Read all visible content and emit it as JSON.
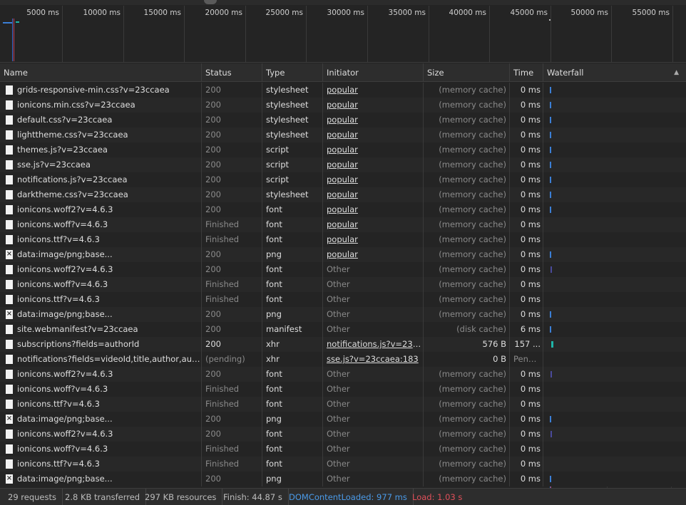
{
  "overview": {
    "ticks": [
      "5000 ms",
      "10000 ms",
      "15000 ms",
      "20000 ms",
      "25000 ms",
      "30000 ms",
      "35000 ms",
      "40000 ms",
      "45000 ms",
      "50000 ms",
      "55000 ms"
    ]
  },
  "columns": {
    "name": "Name",
    "status": "Status",
    "type": "Type",
    "initiator": "Initiator",
    "size": "Size",
    "time": "Time",
    "waterfall": "Waterfall"
  },
  "sort_icon": "triangle-up-icon",
  "rows": [
    {
      "name": "grids-responsive-min.css?v=23ccaea",
      "status": "200",
      "type": "stylesheet",
      "initiator": "popular",
      "init_link": true,
      "size": "(memory cache)",
      "time": "0 ms",
      "icon": "file"
    },
    {
      "name": "ionicons.min.css?v=23ccaea",
      "status": "200",
      "type": "stylesheet",
      "initiator": "popular",
      "init_link": true,
      "size": "(memory cache)",
      "time": "0 ms",
      "icon": "file"
    },
    {
      "name": "default.css?v=23ccaea",
      "status": "200",
      "type": "stylesheet",
      "initiator": "popular",
      "init_link": true,
      "size": "(memory cache)",
      "time": "0 ms",
      "icon": "file"
    },
    {
      "name": "lighttheme.css?v=23ccaea",
      "status": "200",
      "type": "stylesheet",
      "initiator": "popular",
      "init_link": true,
      "size": "(memory cache)",
      "time": "0 ms",
      "icon": "file"
    },
    {
      "name": "themes.js?v=23ccaea",
      "status": "200",
      "type": "script",
      "initiator": "popular",
      "init_link": true,
      "size": "(memory cache)",
      "time": "0 ms",
      "icon": "file"
    },
    {
      "name": "sse.js?v=23ccaea",
      "status": "200",
      "type": "script",
      "initiator": "popular",
      "init_link": true,
      "size": "(memory cache)",
      "time": "0 ms",
      "icon": "file"
    },
    {
      "name": "notifications.js?v=23ccaea",
      "status": "200",
      "type": "script",
      "initiator": "popular",
      "init_link": true,
      "size": "(memory cache)",
      "time": "0 ms",
      "icon": "file"
    },
    {
      "name": "darktheme.css?v=23ccaea",
      "status": "200",
      "type": "stylesheet",
      "initiator": "popular",
      "init_link": true,
      "size": "(memory cache)",
      "time": "0 ms",
      "icon": "file"
    },
    {
      "name": "ionicons.woff2?v=4.6.3",
      "status": "200",
      "type": "font",
      "initiator": "popular",
      "init_link": true,
      "size": "(memory cache)",
      "time": "0 ms",
      "icon": "file"
    },
    {
      "name": "ionicons.woff?v=4.6.3",
      "status": "Finished",
      "type": "font",
      "initiator": "popular",
      "init_link": true,
      "size": "(memory cache)",
      "time": "0 ms",
      "icon": "file"
    },
    {
      "name": "ionicons.ttf?v=4.6.3",
      "status": "Finished",
      "type": "font",
      "initiator": "popular",
      "init_link": true,
      "size": "(memory cache)",
      "time": "0 ms",
      "icon": "file"
    },
    {
      "name": "data:image/png;base...",
      "status": "200",
      "type": "png",
      "initiator": "popular",
      "init_link": true,
      "size": "(memory cache)",
      "time": "0 ms",
      "icon": "image"
    },
    {
      "name": "ionicons.woff2?v=4.6.3",
      "status": "200",
      "type": "font",
      "initiator": "Other",
      "init_link": false,
      "size": "(memory cache)",
      "time": "0 ms",
      "icon": "file"
    },
    {
      "name": "ionicons.woff?v=4.6.3",
      "status": "Finished",
      "type": "font",
      "initiator": "Other",
      "init_link": false,
      "size": "(memory cache)",
      "time": "0 ms",
      "icon": "file"
    },
    {
      "name": "ionicons.ttf?v=4.6.3",
      "status": "Finished",
      "type": "font",
      "initiator": "Other",
      "init_link": false,
      "size": "(memory cache)",
      "time": "0 ms",
      "icon": "file"
    },
    {
      "name": "data:image/png;base...",
      "status": "200",
      "type": "png",
      "initiator": "Other",
      "init_link": false,
      "size": "(memory cache)",
      "time": "0 ms",
      "icon": "image"
    },
    {
      "name": "site.webmanifest?v=23ccaea",
      "status": "200",
      "type": "manifest",
      "initiator": "Other",
      "init_link": false,
      "size": "(disk cache)",
      "time": "6 ms",
      "icon": "file"
    },
    {
      "name": "subscriptions?fields=authorId",
      "status": "200",
      "type": "xhr",
      "initiator": "notifications.js?v=23cc...",
      "init_link": true,
      "size": "576 B",
      "time": "157 ...",
      "icon": "file",
      "active": true
    },
    {
      "name": "notifications?fields=videoId,title,author,author...",
      "status": "(pending)",
      "type": "xhr",
      "initiator": "sse.js?v=23ccaea:183",
      "init_link": true,
      "size": "0 B",
      "time": "Pend...",
      "icon": "file",
      "pending": true
    },
    {
      "name": "ionicons.woff2?v=4.6.3",
      "status": "200",
      "type": "font",
      "initiator": "Other",
      "init_link": false,
      "size": "(memory cache)",
      "time": "0 ms",
      "icon": "file"
    },
    {
      "name": "ionicons.woff?v=4.6.3",
      "status": "Finished",
      "type": "font",
      "initiator": "Other",
      "init_link": false,
      "size": "(memory cache)",
      "time": "0 ms",
      "icon": "file"
    },
    {
      "name": "ionicons.ttf?v=4.6.3",
      "status": "Finished",
      "type": "font",
      "initiator": "Other",
      "init_link": false,
      "size": "(memory cache)",
      "time": "0 ms",
      "icon": "file"
    },
    {
      "name": "data:image/png;base...",
      "status": "200",
      "type": "png",
      "initiator": "Other",
      "init_link": false,
      "size": "(memory cache)",
      "time": "0 ms",
      "icon": "image"
    },
    {
      "name": "ionicons.woff2?v=4.6.3",
      "status": "200",
      "type": "font",
      "initiator": "Other",
      "init_link": false,
      "size": "(memory cache)",
      "time": "0 ms",
      "icon": "file"
    },
    {
      "name": "ionicons.woff?v=4.6.3",
      "status": "Finished",
      "type": "font",
      "initiator": "Other",
      "init_link": false,
      "size": "(memory cache)",
      "time": "0 ms",
      "icon": "file"
    },
    {
      "name": "ionicons.ttf?v=4.6.3",
      "status": "Finished",
      "type": "font",
      "initiator": "Other",
      "init_link": false,
      "size": "(memory cache)",
      "time": "0 ms",
      "icon": "file"
    },
    {
      "name": "data:image/png;base...",
      "status": "200",
      "type": "png",
      "initiator": "Other",
      "init_link": false,
      "size": "(memory cache)",
      "time": "0 ms",
      "icon": "image"
    }
  ],
  "statusbar": {
    "requests": "29 requests",
    "transferred": "2.8 KB transferred",
    "resources": "297 KB resources",
    "finish": "Finish: 44.87 s",
    "dcl": "DOMContentLoaded: 977 ms",
    "load": "Load: 1.03 s"
  },
  "colors": {
    "dcl": "#4a9ae8",
    "load": "#e0505a",
    "bar": "#3b7fd6",
    "active_bar": "#1fb5a8"
  }
}
